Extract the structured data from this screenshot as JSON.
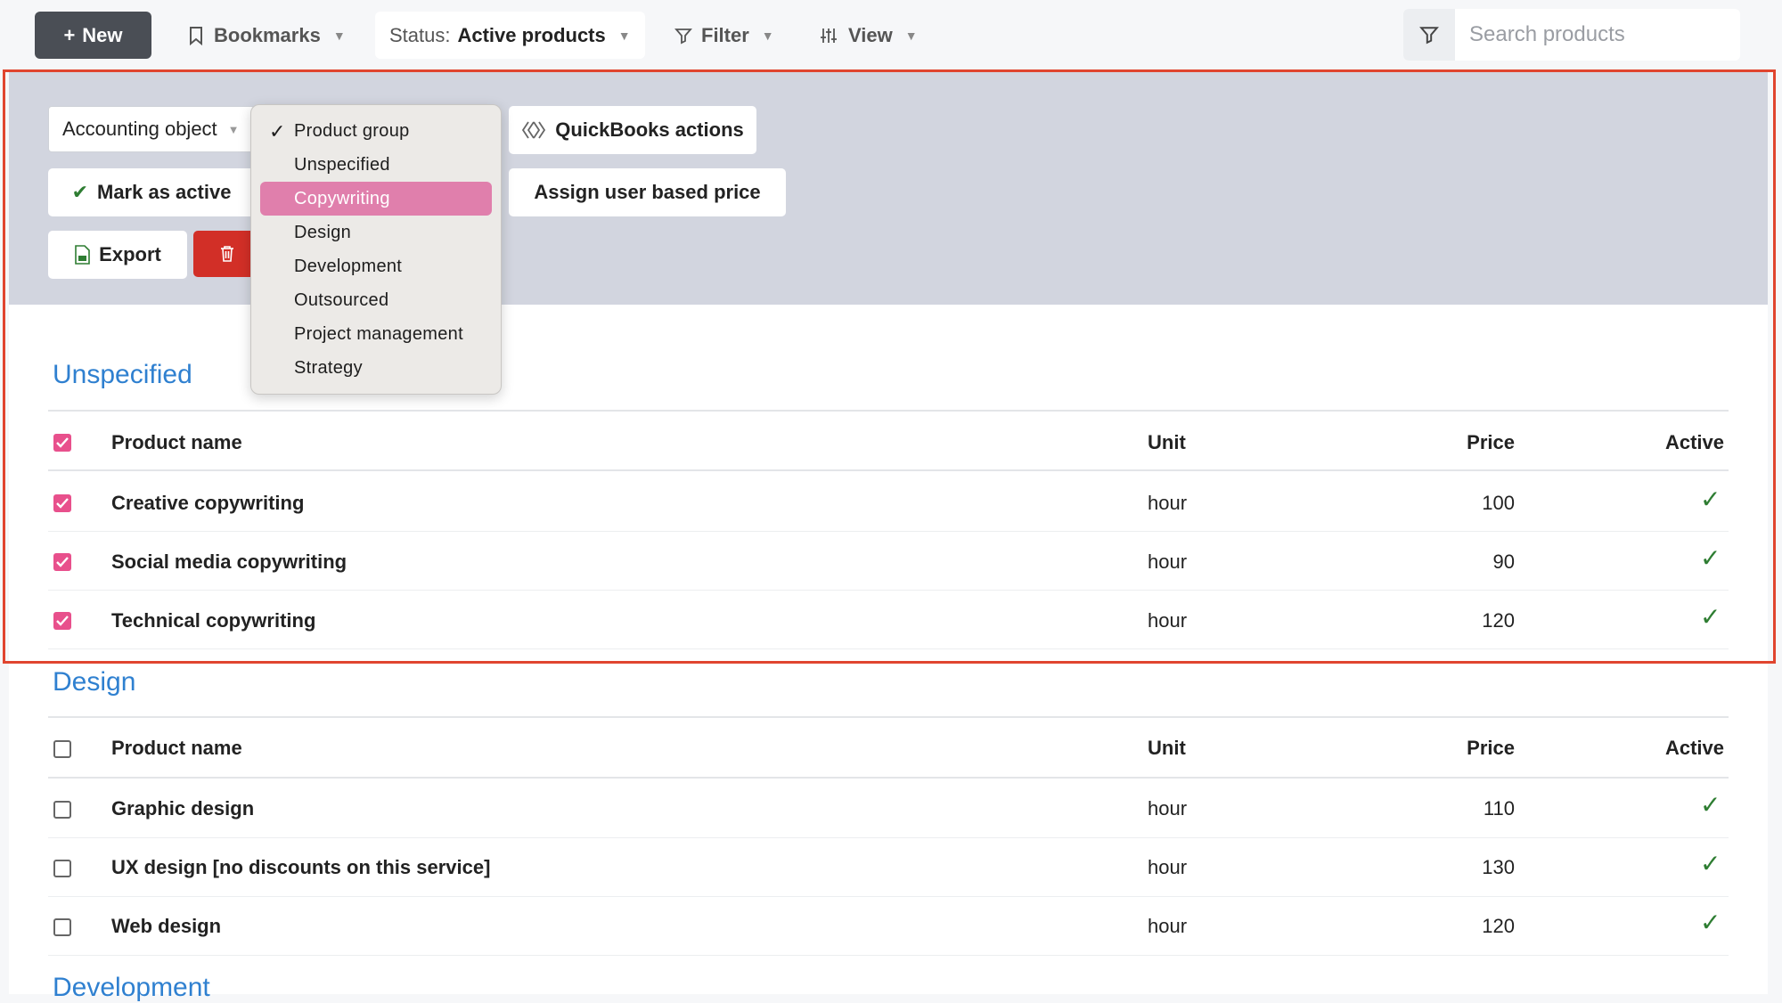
{
  "toolbar": {
    "new_label": "New",
    "bookmarks_label": "Bookmarks",
    "status_label": "Status:",
    "status_value": "Active products",
    "filter_label": "Filter",
    "view_label": "View",
    "search_placeholder": "Search products"
  },
  "actions": {
    "accounting_select": "Accounting object",
    "quickbooks_label": "QuickBooks actions",
    "mark_active_label": "Mark as active",
    "assign_price_label": "Assign user based price",
    "export_label": "Export"
  },
  "dropdown": {
    "items": [
      {
        "label": "Product group",
        "checked": true
      },
      {
        "label": "Unspecified"
      },
      {
        "label": "Copywriting",
        "highlighted": true
      },
      {
        "label": "Design"
      },
      {
        "label": "Development"
      },
      {
        "label": "Outsourced"
      },
      {
        "label": "Project management"
      },
      {
        "label": "Strategy"
      }
    ]
  },
  "table_headers": {
    "name": "Product name",
    "unit": "Unit",
    "price": "Price",
    "active": "Active"
  },
  "groups": [
    {
      "title": "Unspecified",
      "all_checked": true,
      "rows": [
        {
          "name": "Creative copywriting",
          "unit": "hour",
          "price": "100",
          "checked": true,
          "active": true
        },
        {
          "name": "Social media copywriting",
          "unit": "hour",
          "price": "90",
          "checked": true,
          "active": true
        },
        {
          "name": "Technical copywriting",
          "unit": "hour",
          "price": "120",
          "checked": true,
          "active": true
        }
      ]
    },
    {
      "title": "Design",
      "all_checked": false,
      "rows": [
        {
          "name": "Graphic design",
          "unit": "hour",
          "price": "110",
          "checked": false,
          "active": true
        },
        {
          "name": "UX design [no discounts on this service]",
          "unit": "hour",
          "price": "130",
          "checked": false,
          "active": true
        },
        {
          "name": "Web design",
          "unit": "hour",
          "price": "120",
          "checked": false,
          "active": true
        }
      ]
    },
    {
      "title": "Development",
      "rows": []
    }
  ],
  "colors": {
    "accent_pink": "#e8508c",
    "highlight_red": "#e0452f",
    "delete_red": "#d22f27",
    "link_blue": "#2f80d0",
    "tick_green": "#2e7d32"
  }
}
